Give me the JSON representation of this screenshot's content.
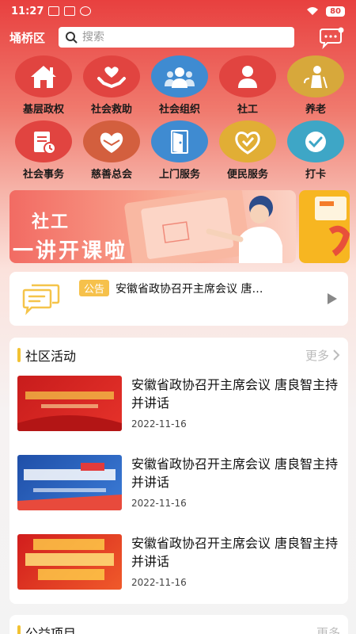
{
  "status": {
    "time": "11:27",
    "battery": "80"
  },
  "header": {
    "location": "埇桥区",
    "search_placeholder": "搜索"
  },
  "grid": [
    {
      "label": "基层政权",
      "icon": "house-icon",
      "color": "#e14440"
    },
    {
      "label": "社会救助",
      "icon": "helping-hands-icon",
      "color": "#e14440"
    },
    {
      "label": "社会组织",
      "icon": "group-icon",
      "color": "#3f8bd1"
    },
    {
      "label": "社工",
      "icon": "person-icon",
      "color": "#e14440"
    },
    {
      "label": "养老",
      "icon": "elderly-icon",
      "color": "#d7a83b"
    },
    {
      "label": "社会事务",
      "icon": "document-clock-icon",
      "color": "#e14440"
    },
    {
      "label": "慈善总会",
      "icon": "heart-hands-icon",
      "color": "#d35f3e"
    },
    {
      "label": "上门服务",
      "icon": "door-icon",
      "color": "#3f8bd1"
    },
    {
      "label": "便民服务",
      "icon": "heart-badge-icon",
      "color": "#e1ae35"
    },
    {
      "label": "打卡",
      "icon": "check-icon",
      "color": "#3ea6c6"
    }
  ],
  "banner": {
    "line1": "社工",
    "line2": "一讲开课啦"
  },
  "notice": {
    "tag": "公告",
    "text": "安徽省政协召开主席会议 唐…"
  },
  "community": {
    "title": "社区活动",
    "more": "更多",
    "items": [
      {
        "title": "安徽省政协召开主席会议 唐良智主持并讲话",
        "date": "2022-11-16",
        "thumb": "red-banner-thumb"
      },
      {
        "title": "安徽省政协召开主席会议 唐良智主持并讲话",
        "date": "2022-11-16",
        "thumb": "blue-banner-thumb"
      },
      {
        "title": "安徽省政协召开主席会议 唐良智主持并讲话",
        "date": "2022-11-16",
        "thumb": "party-banner-thumb"
      }
    ]
  },
  "section2": {
    "title": "公益项目",
    "more": "更多"
  }
}
